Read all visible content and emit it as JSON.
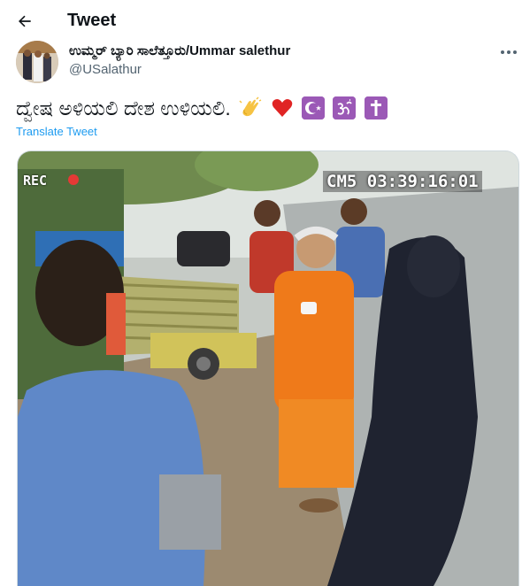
{
  "header": {
    "title": "Tweet"
  },
  "author": {
    "display_name": "ಉಮ್ಮರ್ ಬ್ಯಾರಿ ಸಾಲೆತ್ತೂರು/Ummar salethur",
    "handle": "@USalathur"
  },
  "tweet": {
    "text": "ದ್ವೇಷ ಅಳಿಯಲಿ ದೇಶ ಉಳಿಯಲಿ.",
    "emojis": [
      "clapping-hands",
      "red-heart",
      "star-and-crescent",
      "om",
      "latin-cross"
    ],
    "translate_label": "Translate Tweet"
  },
  "video": {
    "rec_label": "REC",
    "camera_timestamp": "CM5 03:39:16:01"
  },
  "colors": {
    "link": "#1d9bf0",
    "secondary_text": "#536471",
    "emoji_box": "#9b59b6"
  }
}
